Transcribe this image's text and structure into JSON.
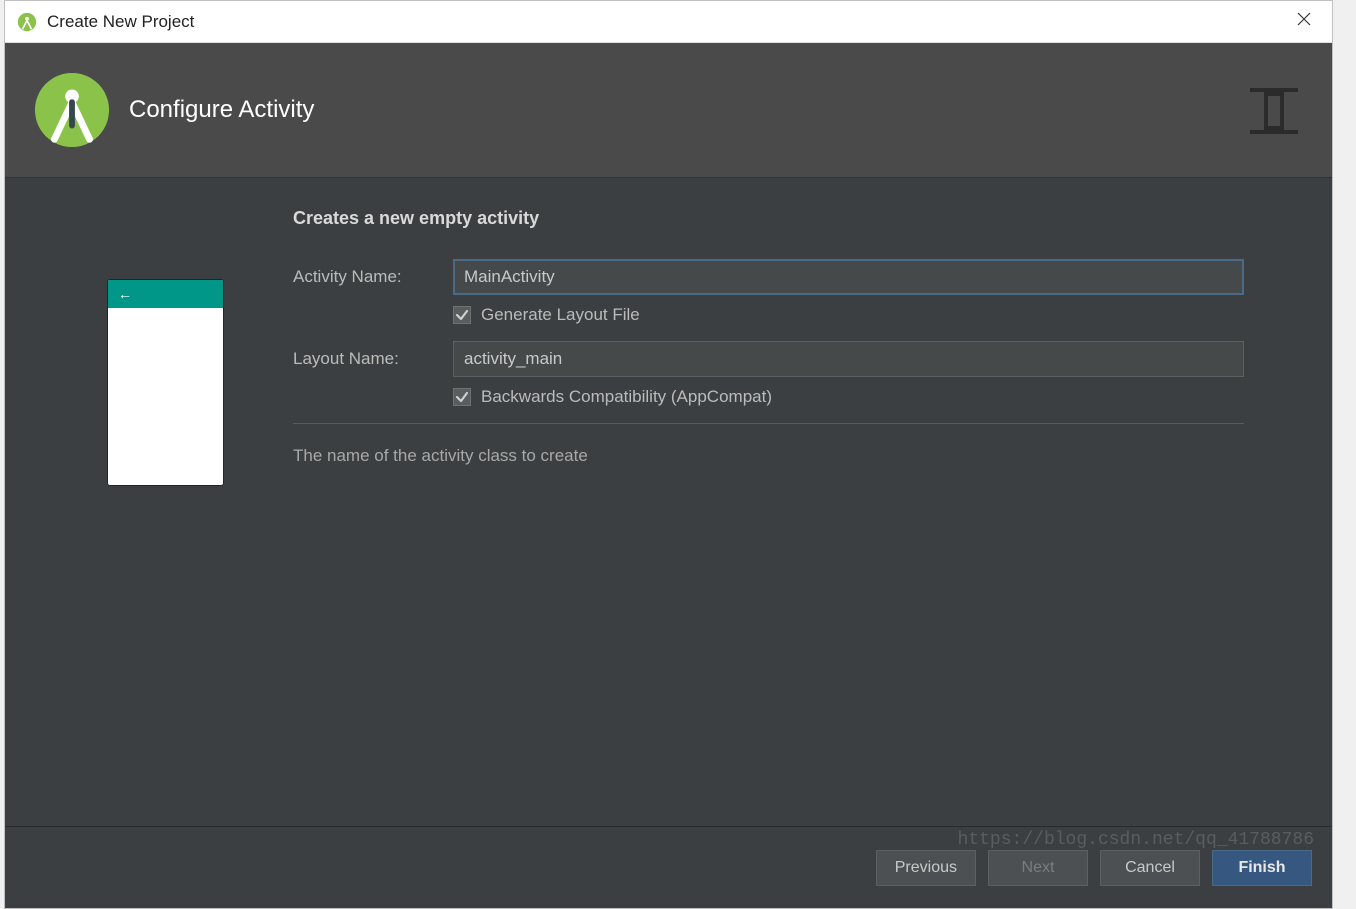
{
  "window": {
    "title": "Create New Project"
  },
  "header": {
    "title": "Configure Activity"
  },
  "form": {
    "section_title": "Creates a new empty activity",
    "activity_name_label": "Activity Name:",
    "activity_name_value": "MainActivity",
    "generate_layout_label": "Generate Layout File",
    "generate_layout_checked": true,
    "layout_name_label": "Layout Name:",
    "layout_name_value": "activity_main",
    "backwards_compat_label": "Backwards Compatibility (AppCompat)",
    "backwards_compat_checked": true,
    "help_text": "The name of the activity class to create"
  },
  "footer": {
    "previous": "Previous",
    "next": "Next",
    "cancel": "Cancel",
    "finish": "Finish"
  },
  "watermark": "https://blog.csdn.net/qq_41788786"
}
